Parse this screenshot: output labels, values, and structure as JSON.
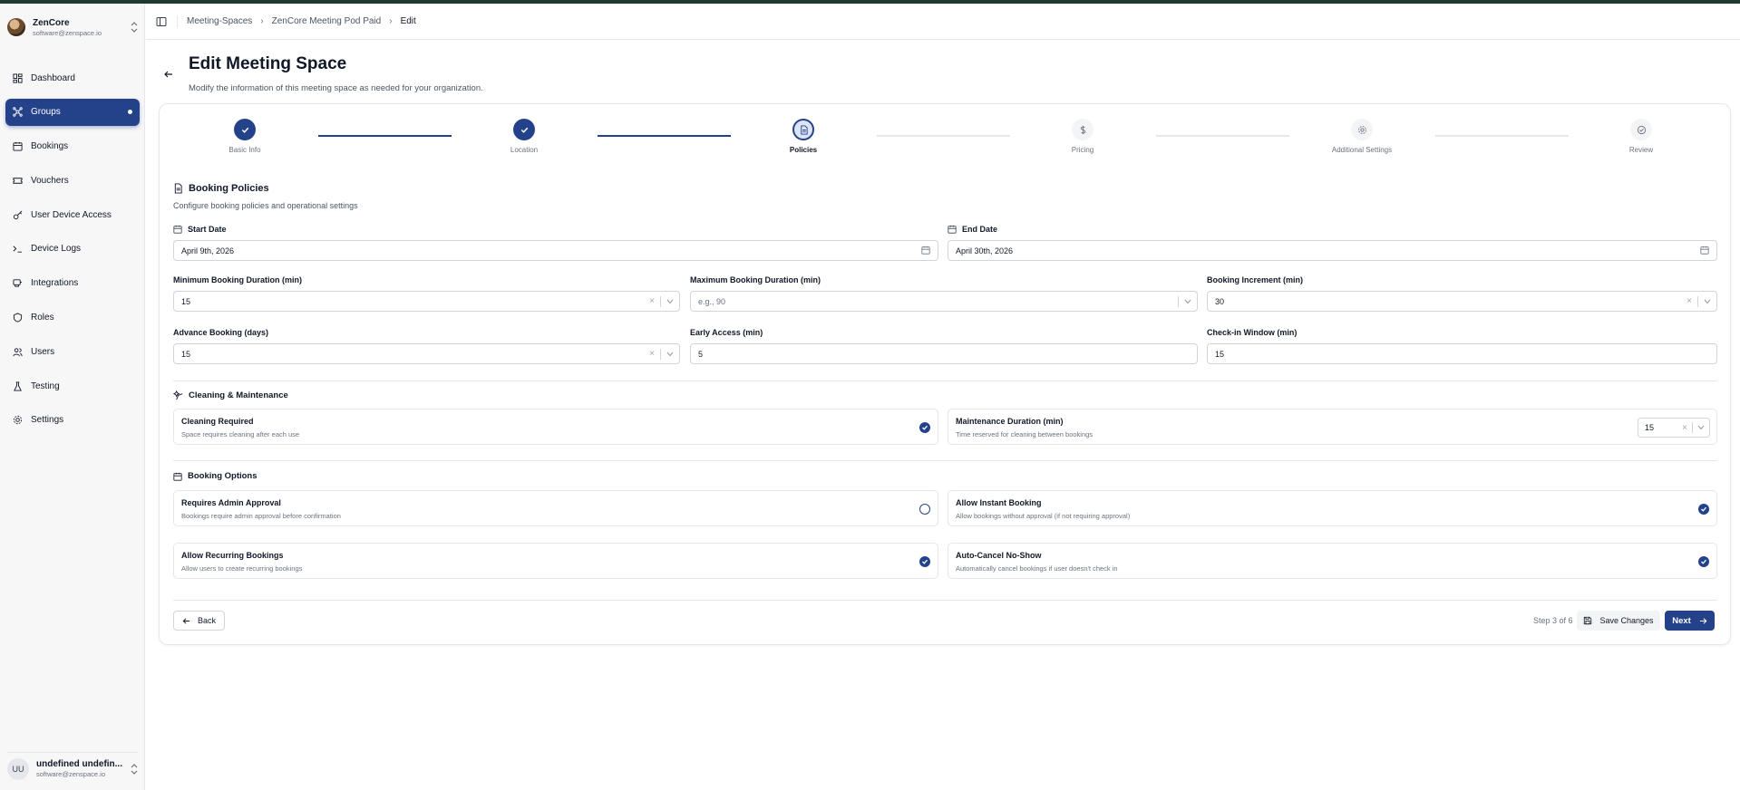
{
  "colors": {
    "primary": "#24428a",
    "border": "#e5e7eb",
    "muted": "#6b7280"
  },
  "sidebar": {
    "brand_name": "ZenCore",
    "brand_email": "software@zenspace.io",
    "items": [
      {
        "label": "Dashboard",
        "icon": "dashboard-icon"
      },
      {
        "label": "Groups",
        "icon": "groups-icon",
        "active": true
      },
      {
        "label": "Bookings",
        "icon": "calendar-icon"
      },
      {
        "label": "Vouchers",
        "icon": "ticket-icon"
      },
      {
        "label": "User Device Access",
        "icon": "key-icon"
      },
      {
        "label": "Device Logs",
        "icon": "terminal-icon"
      },
      {
        "label": "Integrations",
        "icon": "plug-icon"
      },
      {
        "label": "Roles",
        "icon": "shield-icon"
      },
      {
        "label": "Users",
        "icon": "users-icon"
      },
      {
        "label": "Testing",
        "icon": "flask-icon"
      },
      {
        "label": "Settings",
        "icon": "gear-icon"
      }
    ],
    "user": {
      "initials": "UU",
      "name": "undefined undefin...",
      "email": "software@zenspace.io"
    }
  },
  "breadcrumb": [
    "Meeting-Spaces",
    "ZenCore Meeting Pod Paid",
    "Edit"
  ],
  "page": {
    "title": "Edit Meeting Space",
    "subtitle": "Modify the information of this meeting space as needed for your organization."
  },
  "stepper": {
    "steps": [
      {
        "label": "Basic Info",
        "state": "done"
      },
      {
        "label": "Location",
        "state": "done"
      },
      {
        "label": "Policies",
        "state": "current"
      },
      {
        "label": "Pricing",
        "state": "todo"
      },
      {
        "label": "Additional Settings",
        "state": "todo"
      },
      {
        "label": "Review",
        "state": "todo"
      }
    ]
  },
  "policies": {
    "title": "Booking Policies",
    "subtitle": "Configure booking policies and operational settings",
    "start_date": {
      "label": "Start Date",
      "value": "April 9th, 2026"
    },
    "end_date": {
      "label": "End Date",
      "value": "April 30th, 2026"
    },
    "min_duration": {
      "label": "Minimum Booking Duration (min)",
      "value": "15"
    },
    "max_duration": {
      "label": "Maximum Booking Duration (min)",
      "placeholder": "e.g., 90"
    },
    "increment": {
      "label": "Booking Increment (min)",
      "value": "30"
    },
    "advance": {
      "label": "Advance Booking (days)",
      "value": "15"
    },
    "early_access": {
      "label": "Early Access (min)",
      "value": "5"
    },
    "checkin_window": {
      "label": "Check-in Window (min)",
      "value": "15"
    }
  },
  "cleaning": {
    "title": "Cleaning & Maintenance",
    "cleaning_required": {
      "title": "Cleaning Required",
      "desc": "Space requires cleaning after each use",
      "checked": true
    },
    "maintenance": {
      "title": "Maintenance Duration (min)",
      "desc": "Time reserved for cleaning between bookings",
      "value": "15"
    }
  },
  "booking_options": {
    "title": "Booking Options",
    "admin_approval": {
      "title": "Requires Admin Approval",
      "desc": "Bookings require admin approval before confirmation",
      "checked": false
    },
    "instant_booking": {
      "title": "Allow Instant Booking",
      "desc": "Allow bookings without approval (if not requiring approval)",
      "checked": true
    },
    "recurring": {
      "title": "Allow Recurring Bookings",
      "desc": "Allow users to create recurring bookings",
      "checked": true
    },
    "auto_cancel": {
      "title": "Auto-Cancel No-Show",
      "desc": "Automatically cancel bookings if user doesn't check in",
      "checked": true
    }
  },
  "footer": {
    "back_label": "Back",
    "step_count": "Step 3 of 6",
    "save_label": "Save Changes",
    "next_label": "Next"
  }
}
